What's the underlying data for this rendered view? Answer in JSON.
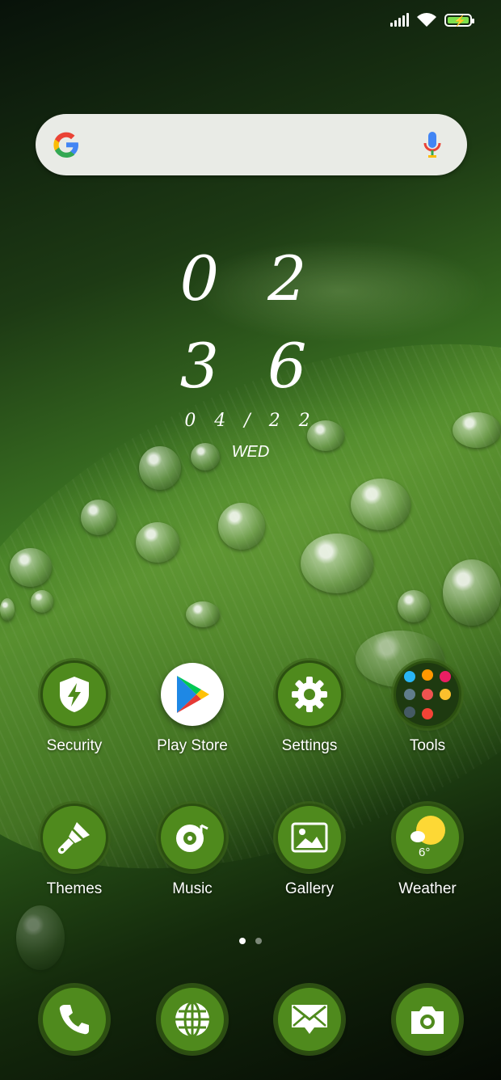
{
  "status_bar": {
    "signal_icon": "signal-icon",
    "wifi_icon": "wifi-icon",
    "battery_icon": "battery-charging-icon"
  },
  "search": {
    "logo_icon": "google-g-icon",
    "mic_icon": "mic-icon"
  },
  "clock": {
    "hours": "0 2",
    "minutes": "3 6",
    "date": "0 4 / 2 2",
    "weekday": "WED"
  },
  "apps_row1": [
    {
      "label": "Security",
      "icon": "shield-lightning-icon"
    },
    {
      "label": "Play Store",
      "icon": "play-store-icon"
    },
    {
      "label": "Settings",
      "icon": "gear-icon"
    },
    {
      "label": "Tools",
      "icon": "folder-icon"
    }
  ],
  "apps_row2": [
    {
      "label": "Themes",
      "icon": "paintbrush-icon"
    },
    {
      "label": "Music",
      "icon": "music-disc-icon"
    },
    {
      "label": "Gallery",
      "icon": "image-icon"
    },
    {
      "label": "Weather",
      "icon": "sun-cloud-icon",
      "temp": "6°"
    }
  ],
  "page_indicator": {
    "pages": 2,
    "active": 1
  },
  "dock": [
    {
      "icon": "phone-icon"
    },
    {
      "icon": "globe-icon"
    },
    {
      "icon": "envelope-icon"
    },
    {
      "icon": "camera-icon"
    }
  ],
  "colors": {
    "icon_green": "#4f8a1d",
    "battery_green": "#7ee04e"
  }
}
